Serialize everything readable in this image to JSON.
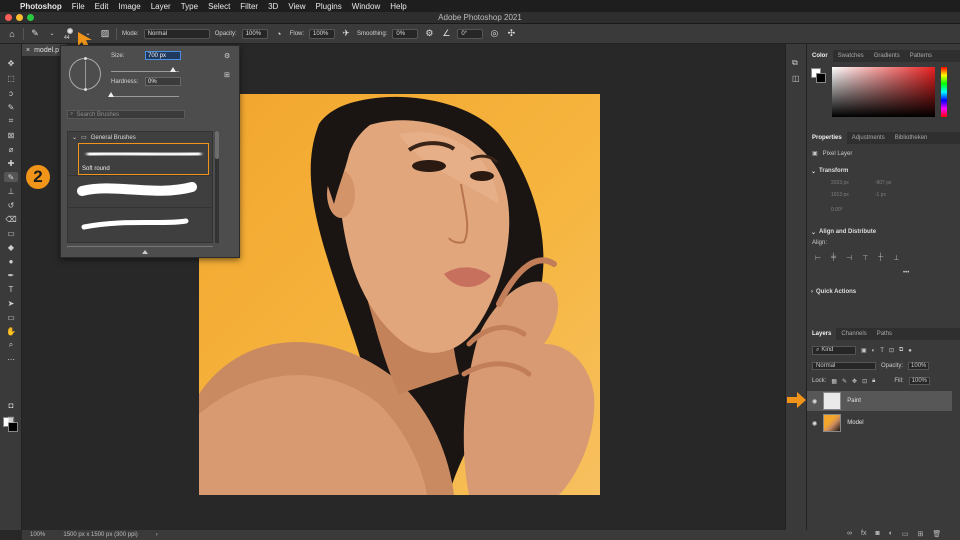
{
  "menubar": {
    "apple": "",
    "items": [
      "Photoshop",
      "File",
      "Edit",
      "Image",
      "Layer",
      "Type",
      "Select",
      "Filter",
      "3D",
      "View",
      "Plugins",
      "Window",
      "Help"
    ]
  },
  "window": {
    "title": "Adobe Photoshop 2021"
  },
  "options": {
    "brush_size": "44",
    "mode_label": "Mode:",
    "mode_value": "Normal",
    "opacity_label": "Opacity:",
    "opacity_value": "100%",
    "flow_label": "Flow:",
    "flow_value": "100%",
    "smoothing_label": "Smoothing:",
    "smoothing_value": "0%",
    "angle_value": "0°"
  },
  "doc_tab": {
    "name": "model.p",
    "close": "×"
  },
  "brush_popup": {
    "size_label": "Size:",
    "size_value": "700 px",
    "hardness_label": "Hardness:",
    "hardness_value": "0%",
    "search_placeholder": "Search Brushes",
    "folder": "General Brushes",
    "brushes": [
      {
        "name": "Soft round"
      },
      {
        "name": ""
      },
      {
        "name": ""
      }
    ]
  },
  "step_badge": "2",
  "status": {
    "zoom": "100%",
    "doc_info": "1500 px x 1500 px (300 ppi)"
  },
  "color_panel": {
    "tabs": [
      "Color",
      "Swatches",
      "Gradients",
      "Patterns"
    ]
  },
  "properties_panel": {
    "tabs": [
      "Properties",
      "Adjustments",
      "Bibliotheken"
    ],
    "layer_type": "Pixel Layer",
    "transform": "Transform",
    "w_value": "2023 px",
    "x_value": "-907 px",
    "h_value": "1013 px",
    "y_value": "-1 px",
    "angle_value": "0.00°",
    "align": "Align and Distribute",
    "align_label": "Align:",
    "quick": "Quick Actions",
    "more": "•••"
  },
  "layers_panel": {
    "tabs": [
      "Layers",
      "Channels",
      "Paths"
    ],
    "kind": "Kind",
    "blend": "Normal",
    "opacity_label": "Opacity:",
    "opacity_value": "100%",
    "lock_label": "Lock:",
    "fill_label": "Fill:",
    "fill_value": "100%",
    "layers": [
      {
        "name": "Paint"
      },
      {
        "name": "Model"
      }
    ]
  },
  "colors": {
    "accent": "#f0951a",
    "canvas_bg": "#f5ae36"
  }
}
